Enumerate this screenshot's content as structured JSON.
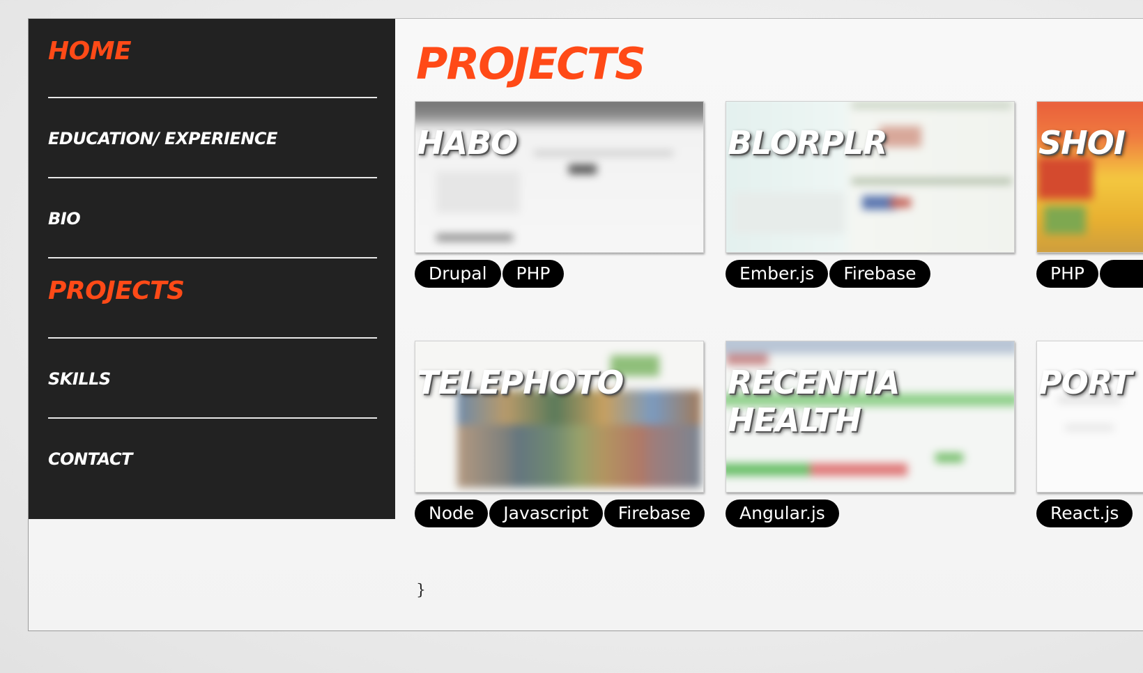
{
  "nav": {
    "items": [
      {
        "label": "Home",
        "active": true
      },
      {
        "label": "Education/ Experience",
        "active": false
      },
      {
        "label": "Bio",
        "active": false
      },
      {
        "label": "Projects",
        "active": true
      },
      {
        "label": "Skills",
        "active": false
      },
      {
        "label": "Contact",
        "active": false
      }
    ]
  },
  "main": {
    "title": "PROJECTS",
    "stray_text": "}"
  },
  "projects": [
    {
      "title": "HABO",
      "tags": [
        "Drupal",
        "PHP"
      ]
    },
    {
      "title": "BLORPLR",
      "tags": [
        "Ember.js",
        "Firebase"
      ]
    },
    {
      "title": "SHOI",
      "tags": [
        "PHP",
        ""
      ]
    },
    {
      "title": "TELEPHOTO",
      "tags": [
        "Node",
        "Javascript",
        "Firebase"
      ]
    },
    {
      "title": "RECENTIA HEALTH",
      "tags": [
        "Angular.js"
      ]
    },
    {
      "title": "PORT",
      "tags": [
        "React.js"
      ]
    }
  ],
  "colors": {
    "accent": "#ff4a17",
    "sidebar_bg": "#222222",
    "tag_bg": "#000000"
  }
}
